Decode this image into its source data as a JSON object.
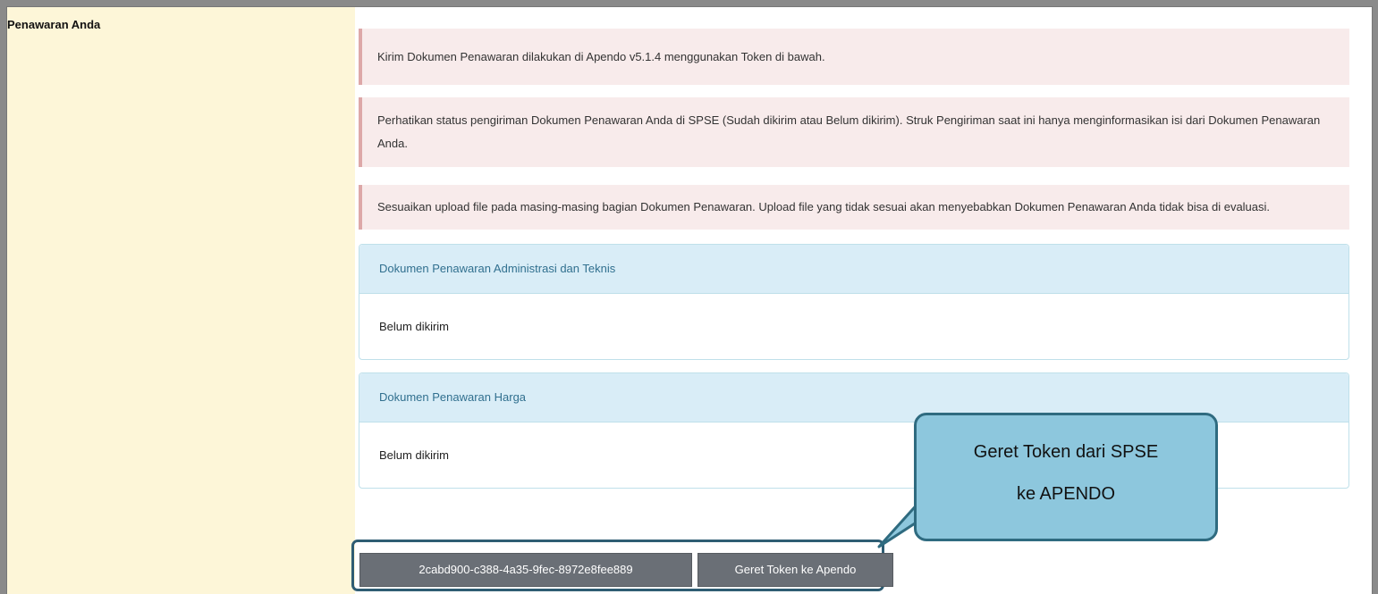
{
  "section_label": "Penawaran Anda",
  "alerts": [
    "Kirim Dokumen Penawaran dilakukan di Apendo v5.1.4 menggunakan Token di bawah.",
    "Perhatikan status pengiriman Dokumen Penawaran Anda di SPSE (Sudah dikirim atau Belum dikirim). Struk Pengiriman saat ini hanya menginformasikan isi dari Dokumen Penawaran Anda.",
    "Sesuaikan upload file pada masing-masing bagian Dokumen Penawaran. Upload file yang tidak sesuai akan menyebabkan Dokumen Penawaran Anda tidak bisa di evaluasi."
  ],
  "panels": [
    {
      "title": "Dokumen Penawaran Administrasi dan Teknis",
      "status": "Belum dikirim"
    },
    {
      "title": "Dokumen Penawaran Harga",
      "status": "Belum dikirim"
    }
  ],
  "token": {
    "value": "2cabd900-c388-4a35-9fec-8972e8fee889",
    "button_label": "Geret Token ke Apendo"
  },
  "callout": {
    "line1": "Geret Token dari SPSE",
    "line2": "ke APENDO"
  }
}
